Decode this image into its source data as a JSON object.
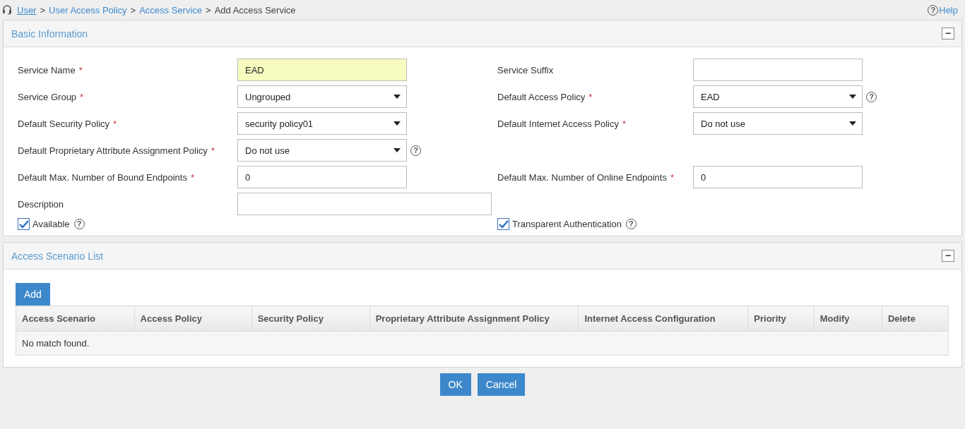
{
  "breadcrumb": {
    "links": [
      "User",
      "User Access Policy",
      "Access Service"
    ],
    "separator": ">",
    "current": "Add Access Service"
  },
  "help_link": {
    "icon": "?",
    "label": "Help"
  },
  "basic_panel": {
    "title": "Basic Information",
    "collapse_symbol": "−",
    "rows": [
      {
        "left": {
          "label": "Service Name",
          "required_mark": "*",
          "kind": "text",
          "value": "EAD",
          "highlighted": true
        },
        "right": {
          "label": "Service Suffix",
          "kind": "text",
          "highlighted": false
        }
      },
      {
        "left": {
          "label": "Service Group",
          "required_mark": "*",
          "kind": "select",
          "value": "Ungrouped",
          "highlighted": false
        },
        "right": {
          "label": "Default Access Policy",
          "required_mark": "*",
          "kind": "select",
          "value": "EAD",
          "highlighted": false,
          "help_icon": "?"
        }
      },
      {
        "left": {
          "label": "Default Security Policy",
          "required_mark": "*",
          "kind": "select",
          "value": "security policy01",
          "highlighted": false
        },
        "right": {
          "label": "Default Internet Access Policy",
          "required_mark": "*",
          "kind": "select",
          "value": "Do not use",
          "highlighted": false
        }
      },
      {
        "left": {
          "label": "Default Proprietary Attribute Assignment Policy",
          "required_mark": "*",
          "kind": "select",
          "value": "Do not use",
          "highlighted": false,
          "help_icon": "?"
        }
      },
      {
        "left": {
          "label": "Default Max. Number of Bound Endpoints",
          "required_mark": "*",
          "kind": "text",
          "value": "0",
          "highlighted": false
        },
        "right": {
          "label": "Default Max. Number of Online Endpoints",
          "required_mark": "*",
          "kind": "text",
          "value": "0",
          "highlighted": false
        }
      },
      {
        "left": {
          "label": "Description",
          "kind": "text",
          "highlighted": false
        }
      }
    ],
    "checkboxes": [
      {
        "label": "Available",
        "checked": true,
        "help_icon": "?"
      },
      {
        "label": "Transparent Authentication",
        "checked": true,
        "help_icon": "?"
      }
    ]
  },
  "scenario_panel": {
    "title": "Access Scenario List",
    "collapse_symbol": "−",
    "add_button": "Add",
    "table": {
      "columns": [
        "Access Scenario",
        "Access Policy",
        "Security Policy",
        "Proprietary Attribute Assignment Policy",
        "Internet Access Configuration",
        "Priority",
        "Modify",
        "Delete"
      ],
      "empty_message": "No match found."
    }
  },
  "buttons": [
    "OK",
    "Cancel"
  ]
}
